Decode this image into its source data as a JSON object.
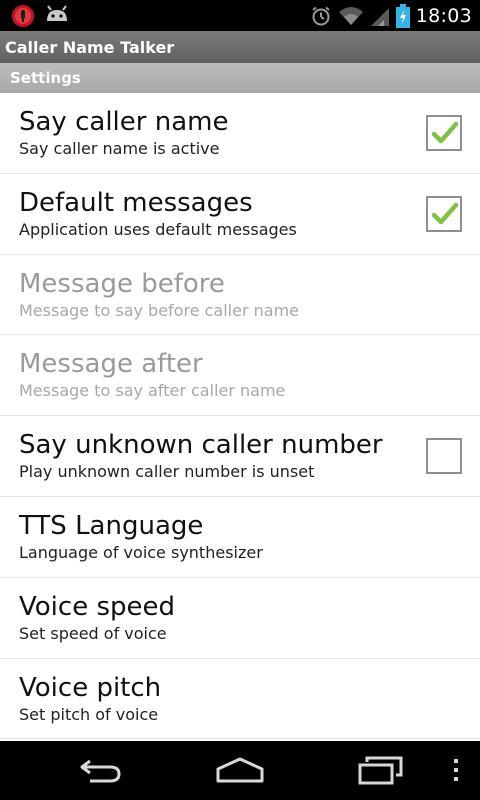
{
  "status_bar": {
    "time": "18:03",
    "icons": [
      "app-notification-icon",
      "android-debug-icon",
      "alarm-icon",
      "wifi-icon",
      "signal-icon",
      "battery-icon"
    ]
  },
  "app": {
    "title": "Caller Name Talker"
  },
  "section": {
    "label": "Settings"
  },
  "preferences": [
    {
      "title": "Say caller name",
      "summary": "Say caller name is active",
      "enabled": true,
      "checkbox": true,
      "checked": true
    },
    {
      "title": "Default messages",
      "summary": "Application uses default messages",
      "enabled": true,
      "checkbox": true,
      "checked": true
    },
    {
      "title": "Message before",
      "summary": "Message to say before caller name",
      "enabled": false,
      "checkbox": false
    },
    {
      "title": "Message after",
      "summary": "Message to say after caller name",
      "enabled": false,
      "checkbox": false
    },
    {
      "title": "Say unknown caller number",
      "summary": "Play unknown caller number is unset",
      "enabled": true,
      "checkbox": true,
      "checked": false
    },
    {
      "title": "TTS Language",
      "summary": "Language of voice synthesizer",
      "enabled": true,
      "checkbox": false
    },
    {
      "title": "Voice speed",
      "summary": "Set speed of voice",
      "enabled": true,
      "checkbox": false
    },
    {
      "title": "Voice pitch",
      "summary": "Set pitch of voice",
      "enabled": true,
      "checkbox": false
    }
  ],
  "nav_bar": {
    "icons": [
      "back-icon",
      "home-icon",
      "recent-apps-icon",
      "overflow-menu-icon"
    ]
  },
  "colors": {
    "status_bar": "#000000",
    "title_bar": "#6e6e6e",
    "section_header": "#b3b3b3",
    "check_green": "#7dc242",
    "disabled_text": "#9a9a9a"
  }
}
